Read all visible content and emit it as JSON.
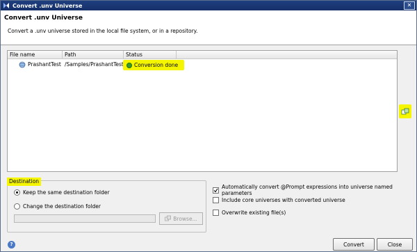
{
  "window": {
    "title": "Convert .unv Universe",
    "close_glyph": "✕"
  },
  "header": {
    "title": "Convert .unv Universe",
    "description": "Convert a .unv universe stored in the local file system, or in a repository."
  },
  "table": {
    "columns": [
      "File name",
      "Path",
      "Status"
    ],
    "rows": [
      {
        "file_name": "PrashantTest",
        "path": "/Samples/PrashantTest",
        "status": "Conversion done",
        "file_icon": "universe-icon",
        "status_icon": "success-icon"
      }
    ]
  },
  "side_button": {
    "icon": "add-universe-icon"
  },
  "destination": {
    "legend": "Destination",
    "options": [
      {
        "label": "Keep the same destination folder",
        "selected": true
      },
      {
        "label": "Change the destination folder",
        "selected": false
      }
    ],
    "folder_value": "",
    "browse_label": "Browse..."
  },
  "options": [
    {
      "label": "Automatically convert @Prompt expressions into universe named parameters",
      "checked": true
    },
    {
      "label": "Include core universes with converted universe",
      "checked": false
    },
    {
      "label": "Overwrite existing file(s)",
      "checked": false
    }
  ],
  "buttons": {
    "convert": "Convert",
    "close": "Close"
  },
  "help": {
    "glyph": "?"
  },
  "colors": {
    "title_bar": "#1f3f7f",
    "highlight": "#f5f500",
    "success": "#3a9a2a"
  }
}
